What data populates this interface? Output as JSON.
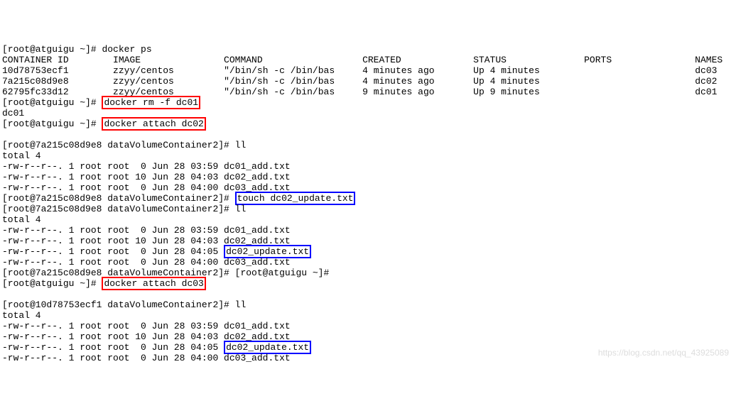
{
  "p_host1": "[root@atguigu ~]# ",
  "cmd_ps": "docker ps",
  "hdr": "CONTAINER ID        IMAGE               COMMAND                  CREATED             STATUS              PORTS               NAMES",
  "row1": {
    "id": "10d78753ecf1",
    "img": "zzyy/centos",
    "cmd": "\"/bin/sh -c /bin/bas",
    "crt": "4 minutes ago",
    "st": "Up 4 minutes",
    "nm": "dc03"
  },
  "row2": {
    "id": "7a215c08d9e8",
    "img": "zzyy/centos",
    "cmd": "\"/bin/sh -c /bin/bas",
    "crt": "4 minutes ago",
    "st": "Up 4 minutes",
    "nm": "dc02"
  },
  "row3": {
    "id": "62795fc33d12",
    "img": "zzyy/centos",
    "cmd": "\"/bin/sh -c /bin/bas",
    "crt": "9 minutes ago",
    "st": "Up 9 minutes",
    "nm": "dc01"
  },
  "cmd_rm": "docker rm -f dc01",
  "out_rm": "dc01",
  "cmd_attach02": "docker attach dc02",
  "p_dvc2": "[root@7a215c08d9e8 dataVolumeContainer2]# ",
  "cmd_ll": "ll",
  "total4": "total 4",
  "ls1": "-rw-r--r--. 1 root root  0 Jun 28 03:59 dc01_add.txt",
  "ls2": "-rw-r--r--. 1 root root 10 Jun 28 04:03 dc02_add.txt",
  "ls3": "-rw-r--r--. 1 root root  0 Jun 28 04:00 dc03_add.txt",
  "cmd_touch": "touch dc02_update.txt",
  "ls4a_pre": "-rw-r--r--. 1 root root  0 Jun 28 04:05 ",
  "ls4a_name": "dc02_update.txt",
  "p_exit": "[root@atguigu ~]#",
  "cmd_attach03": "docker attach dc03",
  "p_dvc3": "[root@10d78753ecf1 dataVolumeContainer2]# ",
  "watermark": "https://blog.csdn.net/qq_43925089"
}
